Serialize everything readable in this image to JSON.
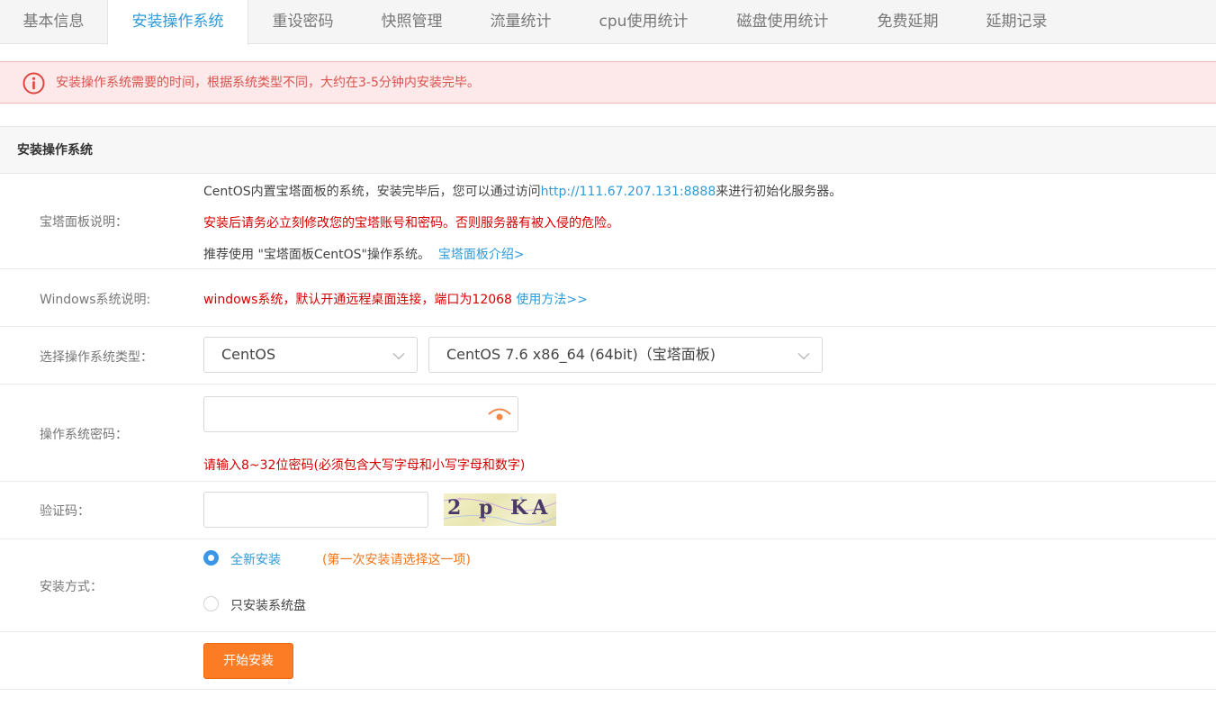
{
  "tabs": [
    "基本信息",
    "安装操作系统",
    "重设密码",
    "快照管理",
    "流量统计",
    "cpu使用统计",
    "磁盘使用统计",
    "免费延期",
    "延期记录"
  ],
  "active_tab_index": 1,
  "alert": {
    "icon": "info-circle-icon",
    "text": "安装操作系统需要的时间，根据系统类型不同，大约在3-5分钟内安装完毕。",
    "color": "#d9534f"
  },
  "section": {
    "title": "安装操作系统"
  },
  "baota": {
    "label": "宝塔面板说明：",
    "line1_prefix": "CentOS内置宝塔面板的系统，安装完毕后，您可以通过访问",
    "line1_link": "http://111.67.207.131:8888",
    "line1_suffix": "来进行初始化服务器。",
    "line2": "安装后请务必立刻修改您的宝塔账号和密码。否则服务器有被入侵的危险。",
    "line3_prefix": "推荐使用 \"宝塔面板CentOS\"操作系统。",
    "line3_link": "宝塔面板介绍>"
  },
  "windows": {
    "label": "Windows系统说明:",
    "text": "windows系统，默认开通远程桌面连接，端口为12068",
    "link": "使用方法>>"
  },
  "os_select": {
    "label": "选择操作系统类型：",
    "type_value": "CentOS",
    "version_value": "CentOS 7.6 x86_64 (64bit)（宝塔面板)"
  },
  "password": {
    "label": "操作系统密码：",
    "value": "",
    "hint": "请输入8~32位密码(必须包含大写字母和小写字母和数字)",
    "toggle_icon": "eye-icon"
  },
  "captcha": {
    "label": "验证码：",
    "value": "",
    "image_text": "2 p KA"
  },
  "install_mode": {
    "label": "安装方式：",
    "options": [
      {
        "label": "全新安装",
        "note": "(第一次安装请选择这一项)",
        "selected": true
      },
      {
        "label": "只安装系统盘",
        "note": "",
        "selected": false
      }
    ]
  },
  "submit_label": "开始安装",
  "colors": {
    "accent": "#2f9bd8",
    "warning_red": "#d40000",
    "button": "#fb7c25",
    "note_orange": "#f0771f"
  }
}
